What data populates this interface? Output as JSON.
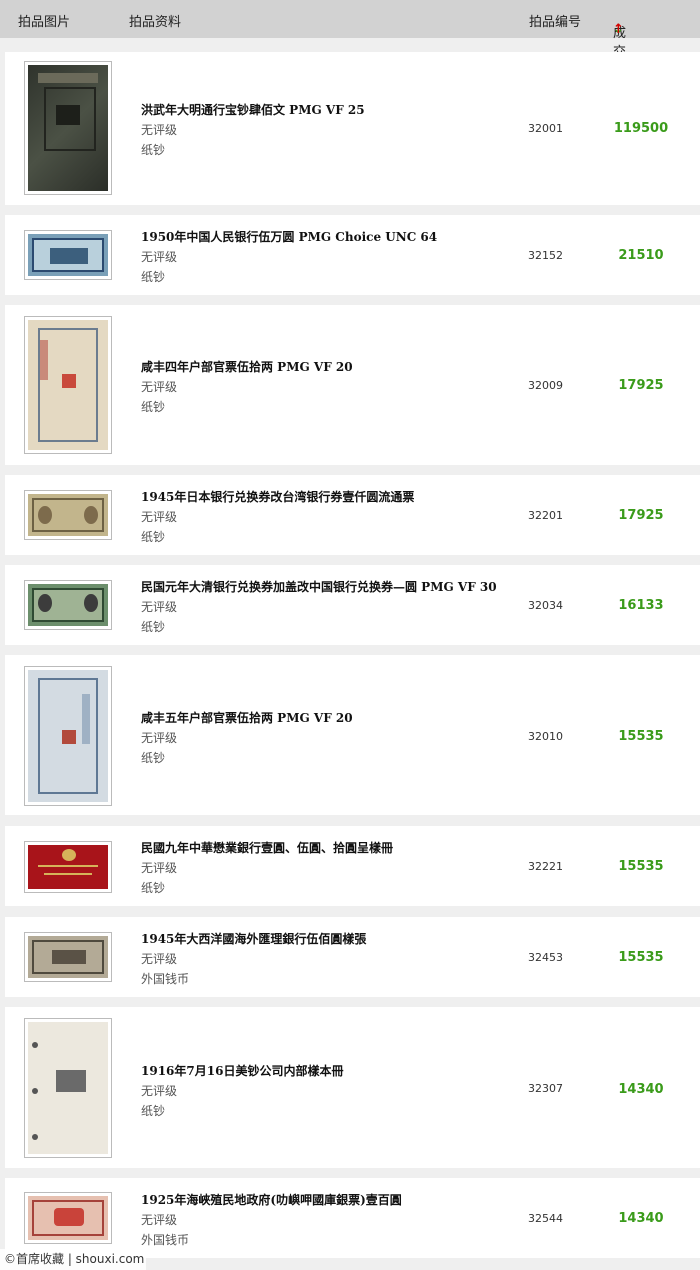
{
  "header": {
    "col_image": "拍品图片",
    "col_info": "拍品资料",
    "col_number": "拍品编号",
    "col_price": "成交价",
    "sort_down": "↓",
    "sort_up": "↑"
  },
  "items": [
    {
      "title": "洪武年大明通行宝钞肆佰文 PMG VF 25",
      "grade": "无评级",
      "category": "纸钞",
      "number": "32001",
      "price": "119500",
      "thumb_color": "#3c4038"
    },
    {
      "title": "1950年中国人民银行伍万圆 PMG Choice UNC 64",
      "grade": "无评级",
      "category": "纸钞",
      "number": "32152",
      "price": "21510",
      "thumb_color": "#5d8aa6"
    },
    {
      "title": "咸丰四年户部官票伍拾两 PMG VF 20",
      "grade": "无评级",
      "category": "纸钞",
      "number": "32009",
      "price": "17925",
      "thumb_color": "#d9c9a8"
    },
    {
      "title": "1945年日本银行兑换券改台湾银行券壹仟圆流通票",
      "grade": "无评级",
      "category": "纸钞",
      "number": "32201",
      "price": "17925",
      "thumb_color": "#b7a77a"
    },
    {
      "title": "民国元年大清银行兑换券加盖改中国银行兑换券—圆 PMG VF 30",
      "grade": "无评级",
      "category": "纸钞",
      "number": "32034",
      "price": "16133",
      "thumb_color": "#4f6e52"
    },
    {
      "title": "咸丰五年户部官票伍拾两 PMG VF 20",
      "grade": "无评级",
      "category": "纸钞",
      "number": "32010",
      "price": "15535",
      "thumb_color": "#c9d3dc"
    },
    {
      "title": "民國九年中華懋業銀行壹圓、伍圓、拾圓呈樣冊",
      "grade": "无评级",
      "category": "纸钞",
      "number": "32221",
      "price": "15535",
      "thumb_color": "#a8141a"
    },
    {
      "title": "1945年大西洋國海外匯理銀行伍佰圓樣張",
      "grade": "无评级",
      "category": "外国钱币",
      "number": "32453",
      "price": "15535",
      "thumb_color": "#8a8070"
    },
    {
      "title": "1916年7月16日美钞公司内部樣本冊",
      "grade": "无评级",
      "category": "纸钞",
      "number": "32307",
      "price": "14340",
      "thumb_color": "#e8e4da"
    },
    {
      "title": "1925年海峽殖民地政府(叻嶼呷國庫銀票)壹百圓",
      "grade": "无评级",
      "category": "外国钱币",
      "number": "32544",
      "price": "14340",
      "thumb_color": "#d47a66"
    }
  ],
  "watermark": "©首席收藏 | shouxi.com"
}
